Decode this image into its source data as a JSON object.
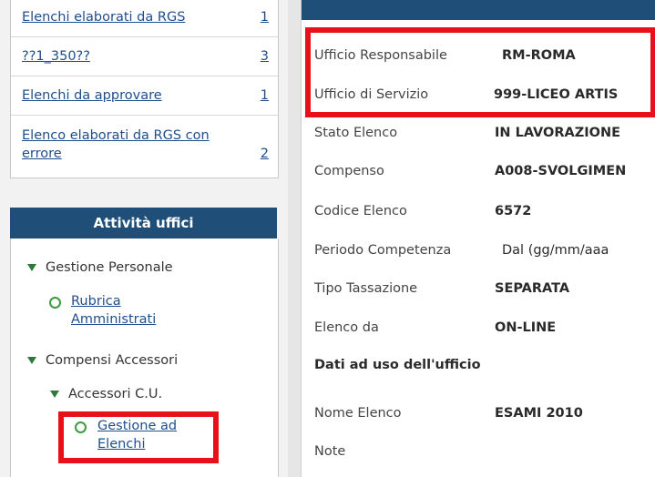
{
  "sidebar": {
    "links": [
      {
        "label": "Elenchi elaborati da RGS",
        "count": "1"
      },
      {
        "label": "??1_350??",
        "count": "3"
      },
      {
        "label": "Elenchi da approvare",
        "count": "1"
      },
      {
        "label": "Elenco elaborati da RGS con errore",
        "count": "2"
      }
    ],
    "activities_title": "Attività uffici",
    "tree": {
      "gestione_personale": "Gestione Personale",
      "rubrica": "Rubrica Amministrati",
      "compensi_accessori": "Compensi Accessori",
      "accessori_cu": "Accessori C.U.",
      "gestione_elenchi": "Gestione ad Elenchi"
    }
  },
  "details": {
    "fields": [
      {
        "label": "Ufficio Responsabile",
        "value": "RM-ROMA"
      },
      {
        "label": "Ufficio di Servizio",
        "value": "999-LICEO ARTIS"
      },
      {
        "label": "Stato Elenco",
        "value": "IN LAVORAZIONE"
      },
      {
        "label": "Compenso",
        "value": "A008-SVOLGIMEN"
      },
      {
        "label": "Codice Elenco",
        "value": "6572"
      },
      {
        "label": "Periodo Competenza",
        "value": "Dal (gg/mm/aaa"
      },
      {
        "label": "Tipo Tassazione",
        "value": "SEPARATA"
      },
      {
        "label": "Elenco da",
        "value": "ON-LINE"
      }
    ],
    "section_title": "Dati ad uso dell'ufficio",
    "office_fields": [
      {
        "label": "Nome Elenco",
        "value": "ESAMI 2010"
      },
      {
        "label": "Note",
        "value": ""
      }
    ]
  },
  "colors": {
    "highlight": "#e8101a",
    "header_blue": "#1f4f78",
    "link_blue": "#1f4e8c",
    "tree_green": "#3d9b3d"
  }
}
